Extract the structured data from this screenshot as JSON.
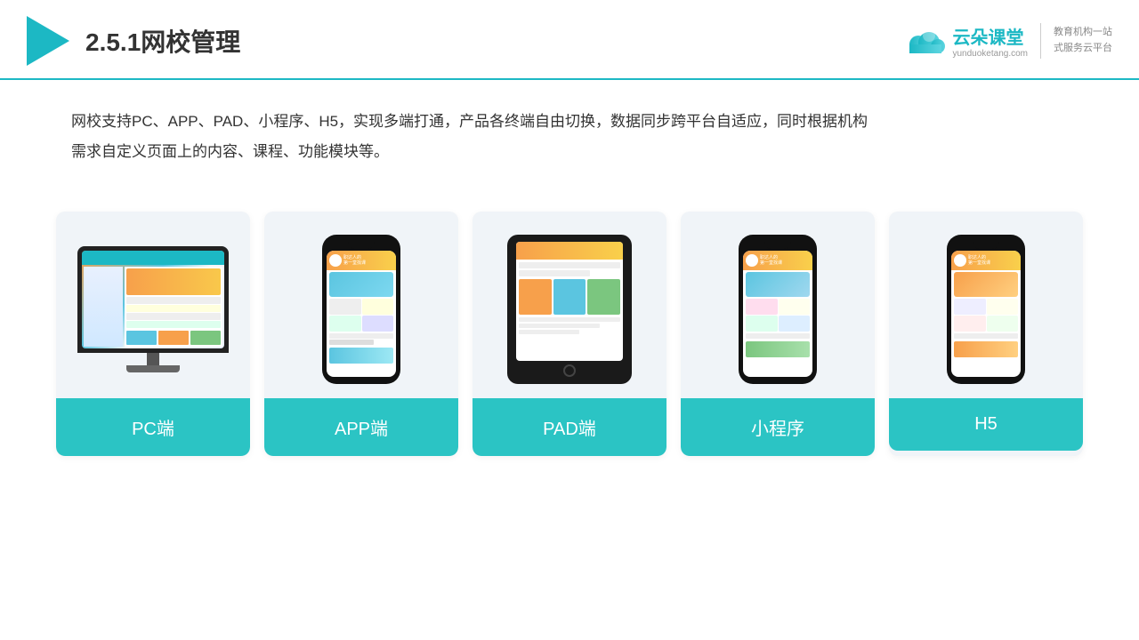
{
  "header": {
    "title": "2.5.1网校管理",
    "brand": {
      "name": "云朵课堂",
      "url": "yunduoketang.com",
      "tagline": "教育机构一站\n式服务云平台"
    }
  },
  "description": {
    "text1": "网校支持PC、APP、PAD、小程序、H5，实现多端打通，产品各终端自由切换，数据同步跨平台自适应，同时根据机构",
    "text2": "需求自定义页面上的内容、课程、功能模块等。"
  },
  "cards": [
    {
      "id": "pc",
      "label": "PC端"
    },
    {
      "id": "app",
      "label": "APP端"
    },
    {
      "id": "pad",
      "label": "PAD端"
    },
    {
      "id": "mini",
      "label": "小程序"
    },
    {
      "id": "h5",
      "label": "H5"
    }
  ]
}
